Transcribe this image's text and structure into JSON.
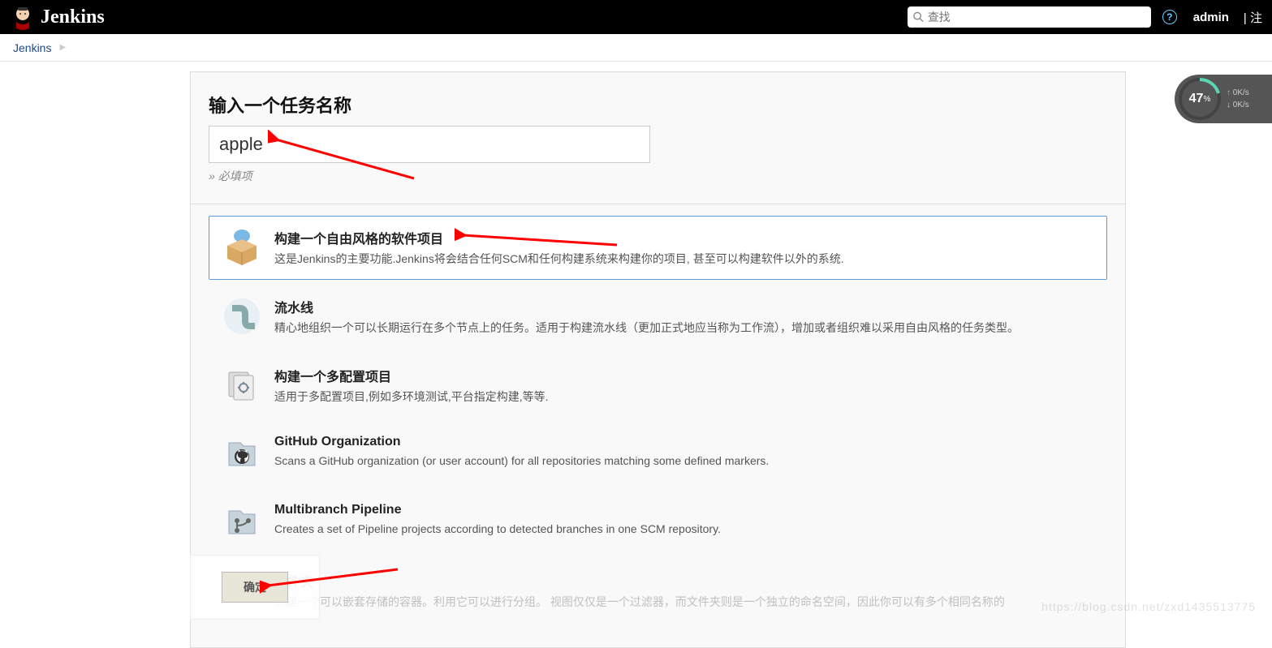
{
  "header": {
    "app_name": "Jenkins",
    "search_placeholder": "查找",
    "user": "admin",
    "divider": "| 注"
  },
  "breadcrumb": {
    "root": "Jenkins"
  },
  "form": {
    "title": "输入一个任务名称",
    "name_value": "apple",
    "required_hint": "» 必填项"
  },
  "jobs": [
    {
      "title": "构建一个自由风格的软件项目",
      "desc": "这是Jenkins的主要功能.Jenkins将会结合任何SCM和任何构建系统来构建你的项目, 甚至可以构建软件以外的系统.",
      "selected": true,
      "icon": "package-icon"
    },
    {
      "title": "流水线",
      "desc": "精心地组织一个可以长期运行在多个节点上的任务。适用于构建流水线（更加正式地应当称为工作流），增加或者组织难以采用自由风格的任务类型。",
      "selected": false,
      "icon": "pipe-icon"
    },
    {
      "title": "构建一个多配置项目",
      "desc": "适用于多配置项目,例如多环境测试,平台指定构建,等等.",
      "selected": false,
      "icon": "multiconfig-icon"
    },
    {
      "title": "GitHub Organization",
      "desc": "Scans a GitHub organization (or user account) for all repositories matching some defined markers.",
      "selected": false,
      "icon": "github-icon"
    },
    {
      "title": "Multibranch Pipeline",
      "desc": "Creates a set of Pipeline projects according to detected branches in one SCM repository.",
      "selected": false,
      "icon": "multibranch-icon"
    },
    {
      "title": "文件夹",
      "desc": "创建一个可以嵌套存储的容器。利用它可以进行分组。 视图仅仅是一个过滤器，而文件夹则是一个独立的命名空间，因此你可以有多个相同名称的",
      "selected": false,
      "icon": "folder-icon",
      "faded": true
    }
  ],
  "ok_label": "确定",
  "gauge": {
    "value": "47",
    "unit": "%",
    "up": "0K/s",
    "down": "0K/s"
  },
  "watermark": "https://blog.csdn.net/zxd1435513775"
}
